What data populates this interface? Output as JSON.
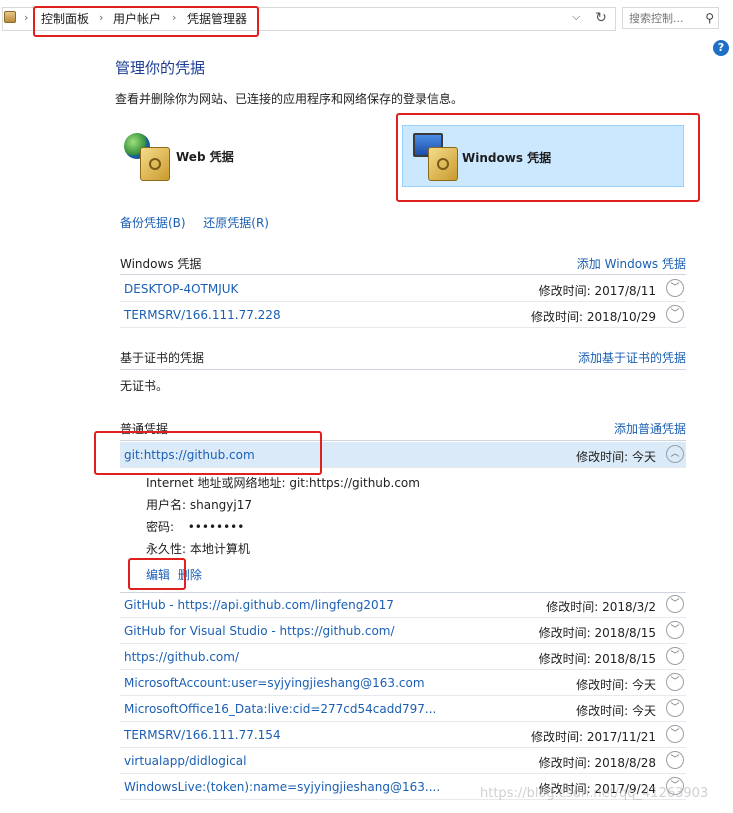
{
  "breadcrumb": [
    "控制面板",
    "用户帐户",
    "凭据管理器"
  ],
  "search": {
    "placeholder": "搜索控制..."
  },
  "help": "?",
  "page": {
    "title": "管理你的凭据",
    "subtitle": "查看并删除你为网站、已连接的应用程序和网络保存的登录信息。"
  },
  "tiles": {
    "web": "Web 凭据",
    "windows": "Windows 凭据"
  },
  "backup": {
    "backup_label": "备份凭据(B)",
    "restore_label": "还原凭据(R)"
  },
  "windows_section": {
    "title": "Windows 凭据",
    "add_label": "添加 Windows 凭据",
    "items": [
      {
        "name": "DESKTOP-4OTMJUK",
        "modified": "修改时间:  2017/8/11"
      },
      {
        "name": "TERMSRV/166.111.77.228",
        "modified": "修改时间:  2018/10/29"
      }
    ]
  },
  "cert_section": {
    "title": "基于证书的凭据",
    "add_label": "添加基于证书的凭据",
    "empty": "无证书。"
  },
  "generic_section": {
    "title": "普通凭据",
    "add_label": "添加普通凭据",
    "expanded": {
      "name": "git:https://github.com",
      "modified": "修改时间:  今天",
      "address": "Internet 地址或网络地址:  git:https://github.com",
      "username": "用户名:  shangyj17",
      "password_label": "密码:",
      "password": "••••••••",
      "persistence": "永久性:  本地计算机",
      "edit_label": "编辑",
      "delete_label": "删除"
    },
    "items": [
      {
        "name": "GitHub - https://api.github.com/lingfeng2017",
        "modified": "修改时间:  2018/3/2"
      },
      {
        "name": "GitHub for Visual Studio - https://github.com/",
        "modified": "修改时间:  2018/8/15"
      },
      {
        "name": "https://github.com/",
        "modified": "修改时间:  2018/8/15"
      },
      {
        "name": "MicrosoftAccount:user=syjyingjieshang@163.com",
        "modified": "修改时间:  今天"
      },
      {
        "name": "MicrosoftOffice16_Data:live:cid=277cd54cadd797...",
        "modified": "修改时间:  今天"
      },
      {
        "name": "TERMSRV/166.111.77.154",
        "modified": "修改时间:  2017/11/21"
      },
      {
        "name": "virtualapp/didlogical",
        "modified": "修改时间:  2018/8/28"
      },
      {
        "name": "WindowsLive:(token):name=syjyingjieshang@163....",
        "modified": "修改时间:  2017/9/24"
      }
    ]
  },
  "watermark": "https://blog.csdn.net/qq_41263903"
}
